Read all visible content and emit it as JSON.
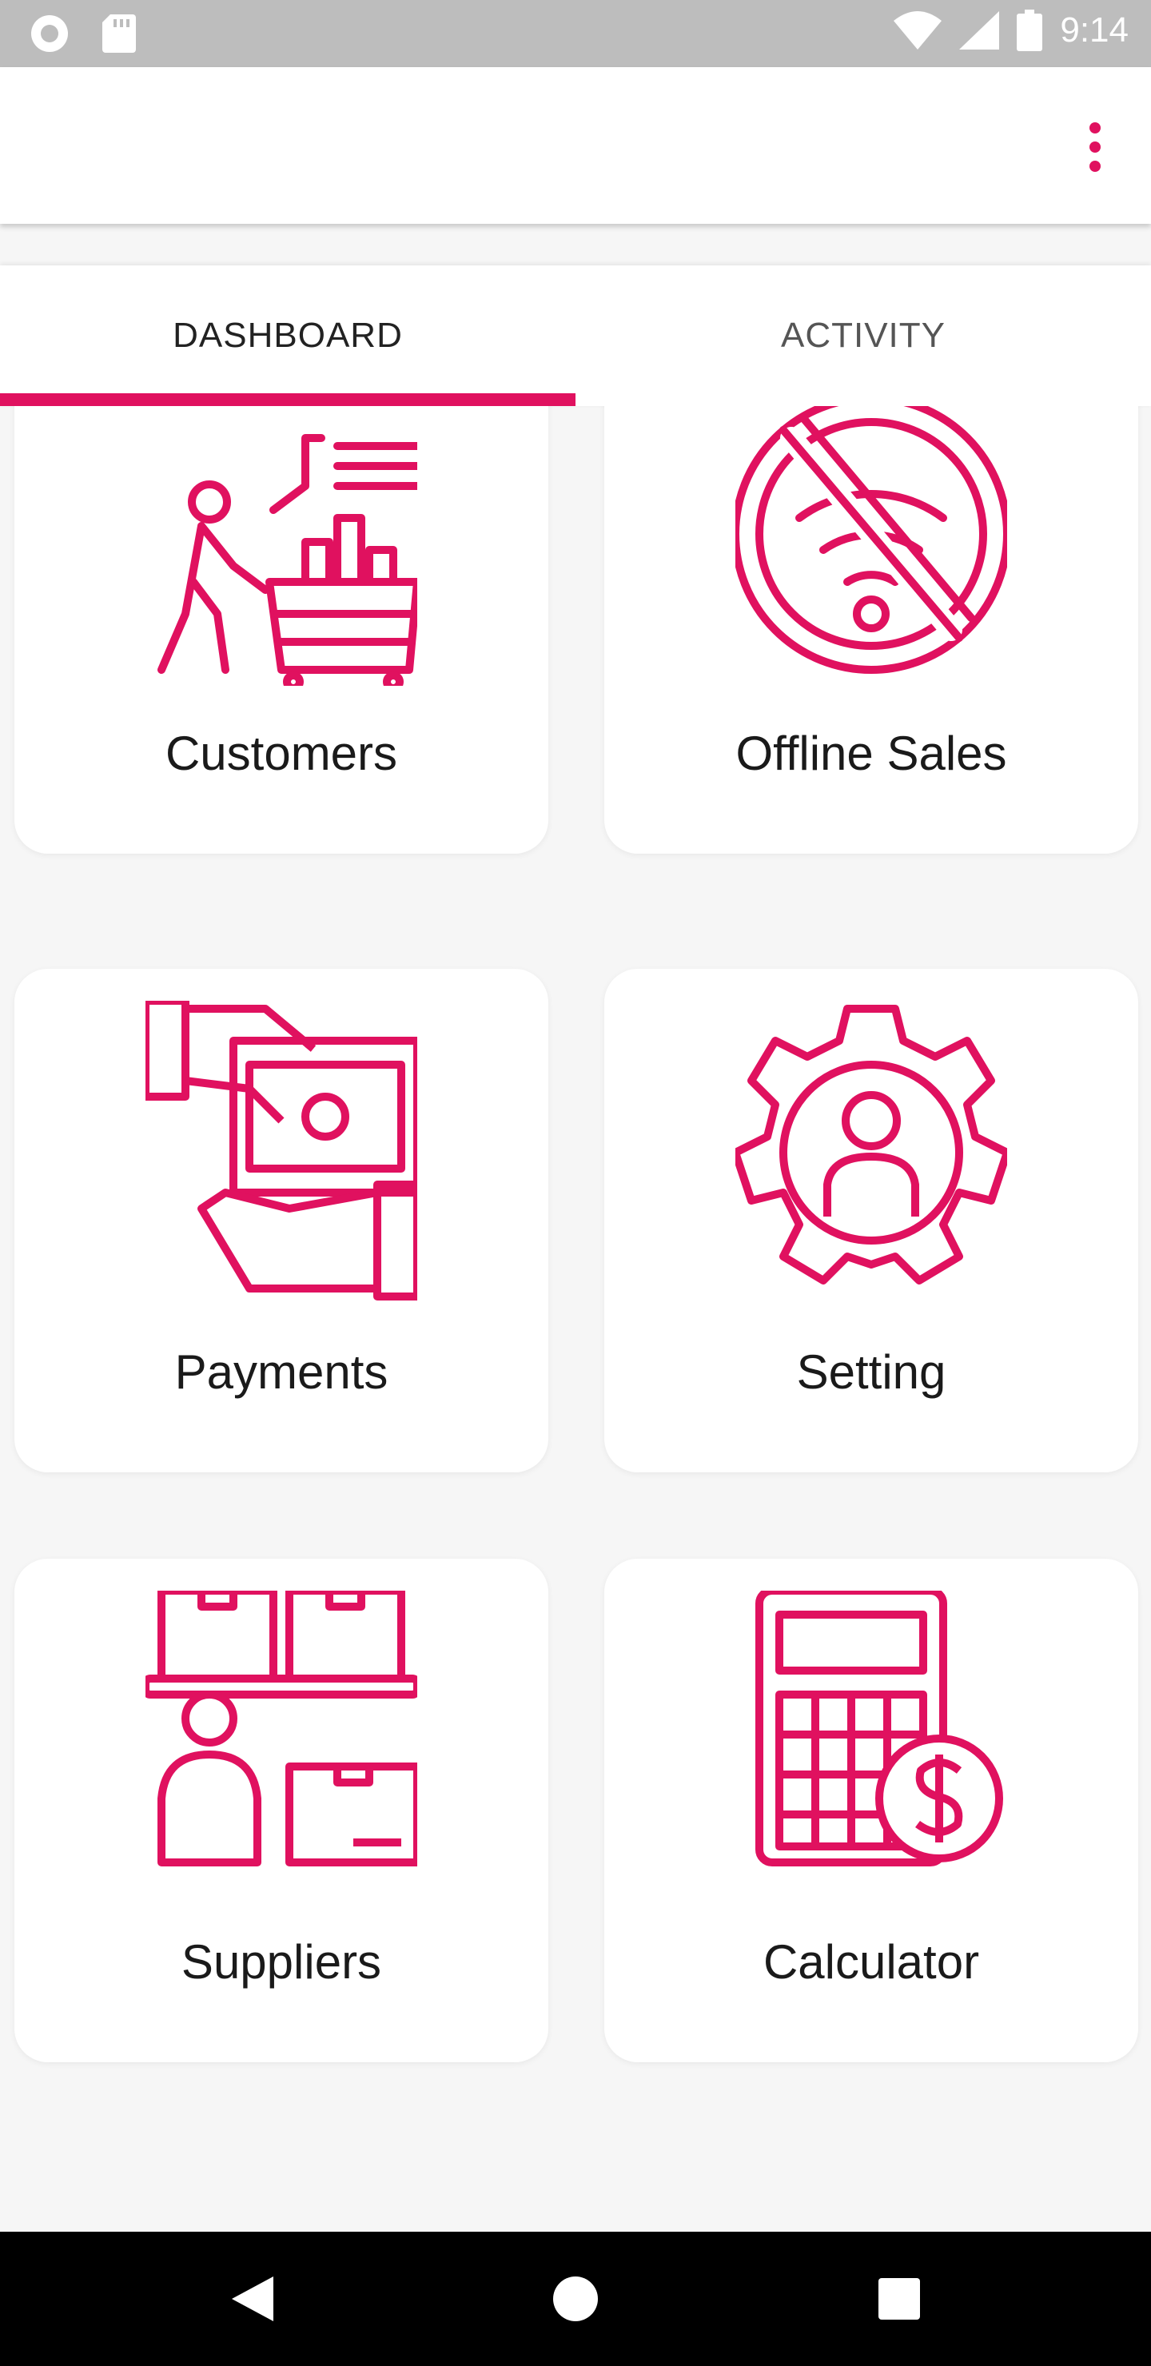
{
  "status_bar": {
    "time": "9:14",
    "icons": [
      "record-icon",
      "sd-card-icon",
      "wifi-icon",
      "signal-icon",
      "battery-icon"
    ]
  },
  "app_bar": {
    "menu_icon": "more-vert-icon"
  },
  "tabs": [
    {
      "label": "DASHBOARD",
      "active": true
    },
    {
      "label": "ACTIVITY",
      "active": false
    }
  ],
  "dashboard": {
    "cards": [
      {
        "label": "Customers",
        "icon": "shopping-cart-person-icon"
      },
      {
        "label": "Offline Sales",
        "icon": "no-wifi-icon"
      },
      {
        "label": "Payments",
        "icon": "payment-hand-money-icon"
      },
      {
        "label": "Setting",
        "icon": "gear-person-icon"
      },
      {
        "label": "Suppliers",
        "icon": "supplier-boxes-icon"
      },
      {
        "label": "Calculator",
        "icon": "calculator-dollar-icon"
      }
    ]
  },
  "colors": {
    "accent": "#e0115f",
    "status_bar": "#bdbdbd",
    "background": "#f6f6f6"
  },
  "nav_bar": {
    "buttons": [
      "back-icon",
      "home-icon",
      "recents-icon"
    ]
  }
}
